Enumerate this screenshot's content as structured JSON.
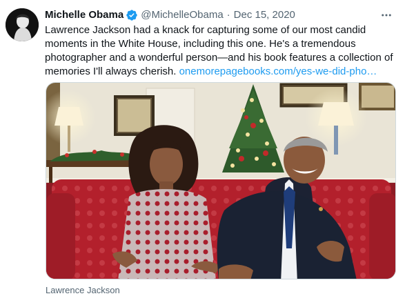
{
  "tweet": {
    "author_name": "Michelle Obama",
    "handle": "@MichelleObama",
    "separator": "·",
    "date": "Dec 15, 2020",
    "body": "Lawrence Jackson had a knack for capturing some of our most candid moments in the White House, including this one. He's a tremendous photographer and a wonderful person—and his book features a collection of memories I'll always cherish.",
    "link": "onemorepagebooks.com/yes-we-did-pho…",
    "photo_credit": "Lawrence Jackson"
  },
  "icons": {
    "verified": "verified-badge-icon",
    "more": "more-options-icon"
  },
  "colors": {
    "link": "#1d9bf0",
    "secondary_text": "#536471",
    "primary_text": "#0f1419",
    "verified": "#1d9bf0"
  }
}
